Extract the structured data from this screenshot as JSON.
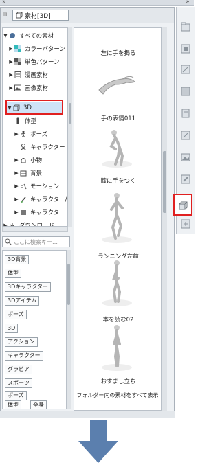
{
  "panel": {
    "tab_label": "素材[3D]"
  },
  "tree": {
    "items": [
      {
        "label": "すべての素材"
      },
      {
        "label": "カラーパターン"
      },
      {
        "label": "単色パターン"
      },
      {
        "label": "漫画素材"
      },
      {
        "label": "画像素材"
      },
      {
        "label": "3D"
      },
      {
        "label": "体型"
      },
      {
        "label": "ポーズ"
      },
      {
        "label": "キャラクター"
      },
      {
        "label": "小物"
      },
      {
        "label": "背景"
      },
      {
        "label": "モーション"
      },
      {
        "label": "キャラクター/"
      },
      {
        "label": "キャラクター"
      },
      {
        "label": "ダウンロード"
      }
    ]
  },
  "search": {
    "placeholder": "ここに検索キー…"
  },
  "tags": {
    "items": [
      "3D背景",
      "体型",
      "3Dキャラクター",
      "3Dアイテム",
      "ポーズ",
      "3D",
      "アクション",
      "キャラクター",
      "グラビア",
      "スポーツ",
      "ポーズ",
      "体型",
      "全身"
    ]
  },
  "materials": {
    "items": [
      {
        "label": "左に手を掲る"
      },
      {
        "label": "手の表情011"
      },
      {
        "label": "膝に手をつく"
      },
      {
        "label": "ランニング左前"
      },
      {
        "label": "本を読む02"
      },
      {
        "label": "おすまし立ち"
      }
    ],
    "show_all": "フォルダー内の素材をすべて表示"
  },
  "colors": {
    "highlight": "#e02020",
    "arrow": "#5b7fae"
  }
}
